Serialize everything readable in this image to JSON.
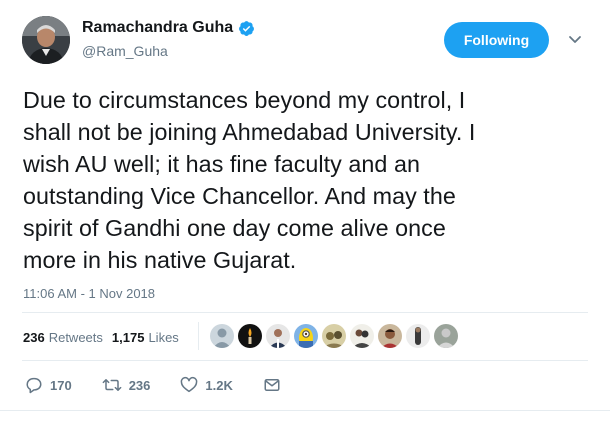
{
  "author": {
    "name": "Ramachandra Guha",
    "handle": "@Ram_Guha",
    "verified": true
  },
  "follow_button": {
    "label": "Following"
  },
  "tweet": {
    "lines": [
      "Due to circumstances beyond my control, I",
      "shall not be joining Ahmedabad University. I",
      "wish AU well; it has fine faculty and an",
      "outstanding Vice Chancellor. And may the",
      "spirit of Gandhi one day come alive once",
      "more in his native Gujarat."
    ],
    "timestamp": "11:06 AM - 1 Nov 2018"
  },
  "stats": {
    "retweets_count": "236",
    "retweets_label": "Retweets",
    "likes_count": "1,175",
    "likes_label": "Likes"
  },
  "actions": {
    "reply_count": "170",
    "retweet_count": "236",
    "like_count": "1.2K"
  },
  "colors": {
    "accent": "#1da1f2",
    "muted": "#657786",
    "text": "#14171a",
    "divider": "#e6ecf0"
  },
  "icons": [
    "verified-badge-icon",
    "chevron-down-icon",
    "reply-icon",
    "retweet-icon",
    "like-icon",
    "message-icon"
  ]
}
